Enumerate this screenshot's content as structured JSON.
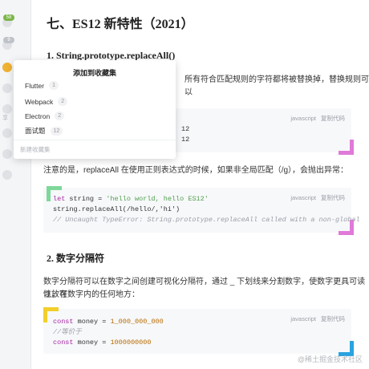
{
  "rail": {
    "badge_top": "58",
    "badge_mid": "9",
    "label": "享"
  },
  "article": {
    "title": "七、ES12 新特性（2021）",
    "section1_title": "1. String.prototype.replaceAll()",
    "section1_para": "所有符合匹配规则的字符都将被替换掉，替换规则可以",
    "code1": {
      "lang": "javascript",
      "copy": "复制代码",
      "lines": [
        "12",
        "12"
      ]
    },
    "note_para": "注意的是，replaceAll 在使用正则表达式的时候，如果非全局匹配（/g），会抛出异常：",
    "code2": {
      "lang": "javascript",
      "copy": "复制代码",
      "line1_kw": "let",
      "line1_rest": " string = ",
      "line1_str": "'hello world, hello ES12'",
      "line2": "string.replaceAll(/hello/,'hi')",
      "line3": "// Uncaught TypeError: String.prototype.replaceAll called with a non-global"
    },
    "section2_title": "2. 数字分隔符",
    "section2_para_1": "数字分隔符可以在数字之间创建可视化分隔符，通过 _ 下划线来分割数字，使数字更具可读性，可",
    "section2_para_2": "以放在数字内的任何地方：",
    "code3": {
      "lang": "javascript",
      "copy": "复制代码",
      "line1_kw": "const",
      "line1_rest": " money = ",
      "line1_num": "1_000_000_000",
      "line2": "//等价于",
      "line3_kw": "const",
      "line3_rest": " money = ",
      "line3_num": "1000000000"
    }
  },
  "dropdown": {
    "title": "添加到收藏集",
    "items": [
      {
        "label": "Flutter",
        "count": "1"
      },
      {
        "label": "Webpack",
        "count": "2"
      },
      {
        "label": "Electron",
        "count": "2"
      },
      {
        "label": "面试题",
        "count": "12"
      }
    ],
    "new_label": "新建收藏集"
  },
  "watermark": "@稀土掘金技术社区",
  "colors": {
    "corner_green": "#7ed89a",
    "corner_pink": "#e07ad8",
    "corner_yellow": "#f2cf2a",
    "corner_blue": "#2aa3e0"
  }
}
